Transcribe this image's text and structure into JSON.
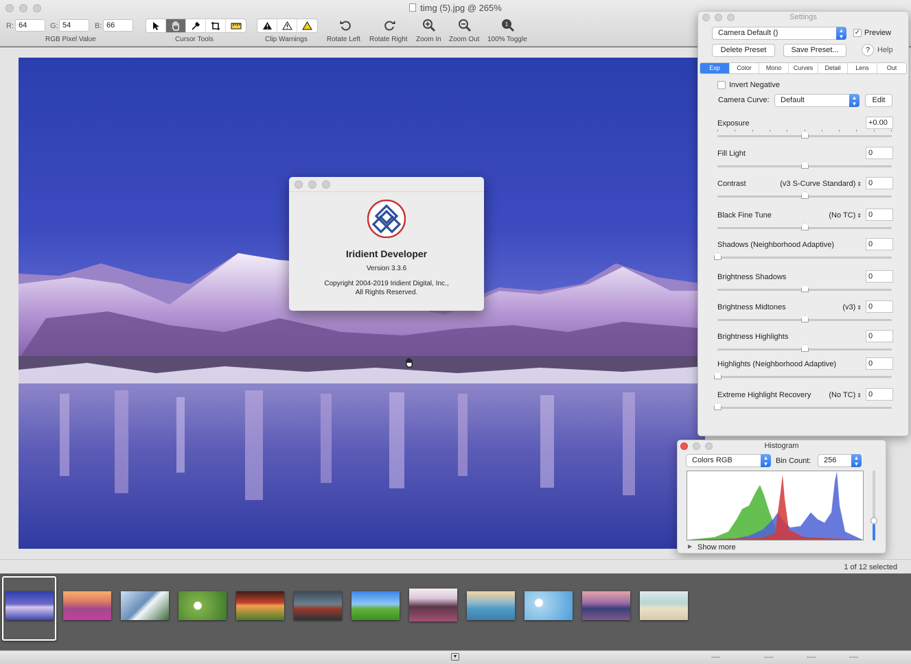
{
  "window": {
    "title": "timg (5).jpg @ 265%"
  },
  "toolbar": {
    "rgb": {
      "r_label": "R:",
      "r_value": "64",
      "g_label": "G:",
      "g_value": "54",
      "b_label": "B:",
      "b_value": "66",
      "caption": "RGB Pixel Value"
    },
    "cursor_tools": {
      "caption": "Cursor Tools",
      "icons": [
        "arrow-icon",
        "hand-icon",
        "eyedropper-icon",
        "crop-icon",
        "ruler-icon"
      ],
      "selected": "hand-icon"
    },
    "clip_warnings": {
      "caption": "Clip Warnings",
      "icons": [
        "warning-black-icon",
        "warning-outline-icon",
        "warning-yellow-icon"
      ]
    },
    "rotate_left": "Rotate Left",
    "rotate_right": "Rotate Right",
    "zoom_in": "Zoom In",
    "zoom_out": "Zoom Out",
    "toggle_100": "100% Toggle"
  },
  "about": {
    "app_name": "Iridient Developer",
    "version": "Version 3.3.6",
    "copyright_line1": "Copyright 2004-2019 Iridient Digital, Inc.,",
    "copyright_line2": "All Rights Reserved."
  },
  "settings": {
    "title": "Settings",
    "preset": "Camera Default ()",
    "preview_label": "Preview",
    "preview_checked": true,
    "delete_preset": "Delete Preset",
    "save_preset": "Save Preset...",
    "help": "Help",
    "tabs": [
      {
        "label": "Exp",
        "active": true
      },
      {
        "label": "Color",
        "active": false
      },
      {
        "label": "Mono",
        "active": false
      },
      {
        "label": "Curves",
        "active": false
      },
      {
        "label": "Detail",
        "active": false
      },
      {
        "label": "Lens",
        "active": false
      },
      {
        "label": "Out",
        "active": false
      }
    ],
    "invert_negative": "Invert Negative",
    "camera_curve_label": "Camera Curve:",
    "camera_curve_value": "Default",
    "edit": "Edit",
    "sliders": [
      {
        "label": "Exposure",
        "mode": "",
        "value": "+0.00",
        "level": 0.5
      },
      {
        "label": "Fill Light",
        "mode": "",
        "value": "0",
        "level": 0.5
      },
      {
        "label": "Contrast",
        "mode": "(v3 S-Curve Standard)",
        "value": "0",
        "level": 0.5
      },
      {
        "label": "Black Fine Tune",
        "mode": "(No TC)",
        "value": "0",
        "level": 0.5
      },
      {
        "label": "Shadows (Neighborhood Adaptive)",
        "mode": "",
        "value": "0",
        "level": 0.0
      },
      {
        "label": "Brightness Shadows",
        "mode": "",
        "value": "0",
        "level": 0.5
      },
      {
        "label": "Brightness Midtones",
        "mode": "(v3)",
        "value": "0",
        "level": 0.5
      },
      {
        "label": "Brightness Highlights",
        "mode": "",
        "value": "0",
        "level": 0.5
      },
      {
        "label": "Highlights (Neighborhood Adaptive)",
        "mode": "",
        "value": "0",
        "level": 0.0
      },
      {
        "label": "Extreme Highlight Recovery",
        "mode": "(No TC)",
        "value": "0",
        "level": 0.0
      }
    ]
  },
  "histogram": {
    "title": "Histogram",
    "channel": "Colors RGB",
    "bin_count_label": "Bin Count:",
    "bin_count": "256",
    "show_more": "Show more"
  },
  "filmstrip": {
    "selection_count": "1 of 12 selected",
    "selected_index": 0
  },
  "statusbar": {
    "fields": [
      "----",
      "----",
      "----",
      "----"
    ]
  }
}
